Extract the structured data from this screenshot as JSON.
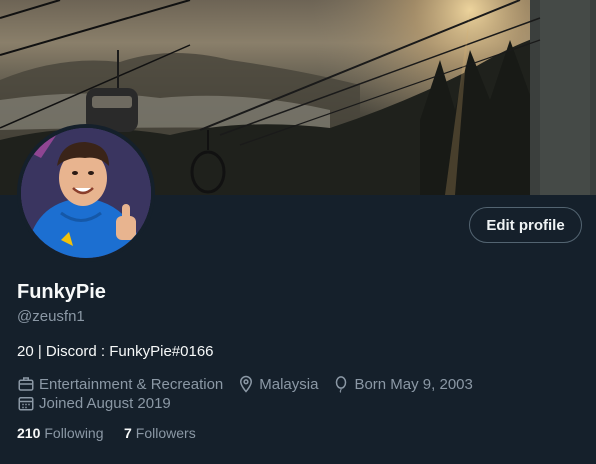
{
  "profile": {
    "name": "FunkyPie",
    "handle": "@zeusfn1",
    "bio": "20 | Discord : FunkyPie#0166",
    "category": "Entertainment & Recreation",
    "location": "Malaysia",
    "born": "Born May 9, 2003",
    "joined": "Joined August 2019",
    "following_count": "210",
    "following_label": "Following",
    "followers_count": "7",
    "followers_label": "Followers"
  },
  "actions": {
    "edit_profile_label": "Edit profile"
  },
  "icons": {
    "category": "briefcase-icon",
    "location": "location-pin-icon",
    "born": "balloon-icon",
    "joined": "calendar-icon"
  },
  "colors": {
    "background": "#15202b",
    "text_primary": "#f7f9f9",
    "text_secondary": "#8b98a5",
    "button_border": "#536471"
  }
}
